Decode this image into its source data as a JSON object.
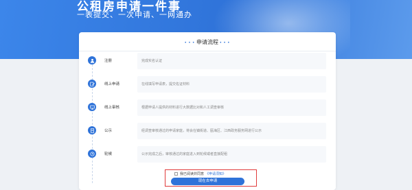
{
  "banner": {
    "title": "公租房申请一件事",
    "subtitle": "一表提交、一次申请、一网通办"
  },
  "process": {
    "title": "申请流程",
    "steps": [
      {
        "name": "注册",
        "desc": "完成实名认证",
        "icon": "user-icon"
      },
      {
        "name": "线上申请",
        "desc": "在线填写申请表，提交佐证材料",
        "icon": "edit-icon"
      },
      {
        "name": "线上审核",
        "desc": "根据申请人提供的材料进行大数据比对和人工调查审核",
        "icon": "monitor-icon"
      },
      {
        "name": "公示",
        "desc": "经调查审核通过的申请家庭，将会在镇街道、瓯海区、江西政务服务网进行公示",
        "icon": "document-icon"
      },
      {
        "name": "轮候",
        "desc": "公示完成之后，审核通过的家庭进入到轮候或者直接配租",
        "icon": "clock-icon"
      }
    ]
  },
  "footer": {
    "agree_text": "我已阅读并同意",
    "agree_link": "《申请须知》",
    "apply_label": "现在去申请"
  },
  "colors": {
    "accent": "#2f73d9",
    "highlight_border": "#e03a3a"
  }
}
